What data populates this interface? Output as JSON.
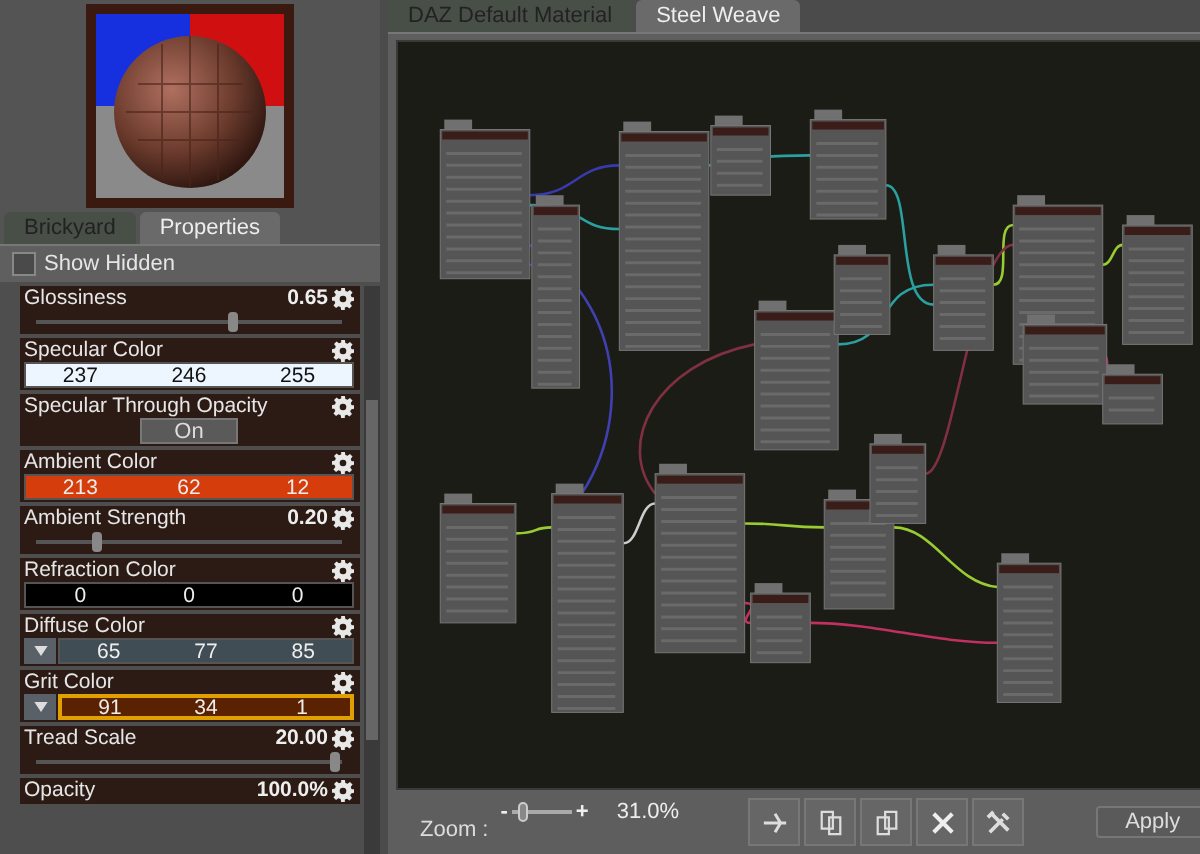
{
  "left_tabs": [
    {
      "label": "Brickyard",
      "selected": false
    },
    {
      "label": "Properties",
      "selected": true
    }
  ],
  "show_hidden": {
    "label": "Show Hidden",
    "checked": false
  },
  "properties": [
    {
      "kind": "slider",
      "label": "Glossiness",
      "value": "0.65",
      "level": 0.65
    },
    {
      "kind": "color",
      "label": "Specular Color",
      "values": [
        "237",
        "246",
        "255"
      ],
      "color": "#edf6ff",
      "map": false,
      "selected": false
    },
    {
      "kind": "toggle",
      "label": "Specular Through Opacity",
      "button": "On"
    },
    {
      "kind": "color",
      "label": "Ambient Color",
      "values": [
        "213",
        "62",
        "12"
      ],
      "color": "#d53e0c",
      "map": false,
      "selected": false
    },
    {
      "kind": "slider",
      "label": "Ambient Strength",
      "value": "0.20",
      "level": 0.2
    },
    {
      "kind": "color",
      "label": "Refraction Color",
      "values": [
        "0",
        "0",
        "0"
      ],
      "color": "#000000",
      "map": false,
      "selected": false
    },
    {
      "kind": "color",
      "label": "Diffuse Color",
      "values": [
        "65",
        "77",
        "85"
      ],
      "color": "#414d55",
      "map": true,
      "selected": false
    },
    {
      "kind": "color",
      "label": "Grit Color",
      "values": [
        "91",
        "34",
        "1"
      ],
      "color": "#5b2201",
      "map": true,
      "selected": true
    },
    {
      "kind": "slider",
      "label": "Tread Scale",
      "value": "20.00",
      "level": 0.98
    },
    {
      "kind": "slider",
      "label": "Opacity",
      "value": "100.0%"
    }
  ],
  "editor_tabs": [
    {
      "label": "DAZ Default Material",
      "selected": false
    },
    {
      "label": "Steel Weave",
      "selected": true
    }
  ],
  "zoom": {
    "label": "Zoom :",
    "minus": "-",
    "plus": "+",
    "level": 0.1,
    "value": "31.0%"
  },
  "tools": [
    {
      "kind": "cut"
    },
    {
      "kind": "copy"
    },
    {
      "kind": "paste"
    },
    {
      "kind": "delete"
    },
    {
      "kind": "tools"
    }
  ],
  "apply": "Apply"
}
